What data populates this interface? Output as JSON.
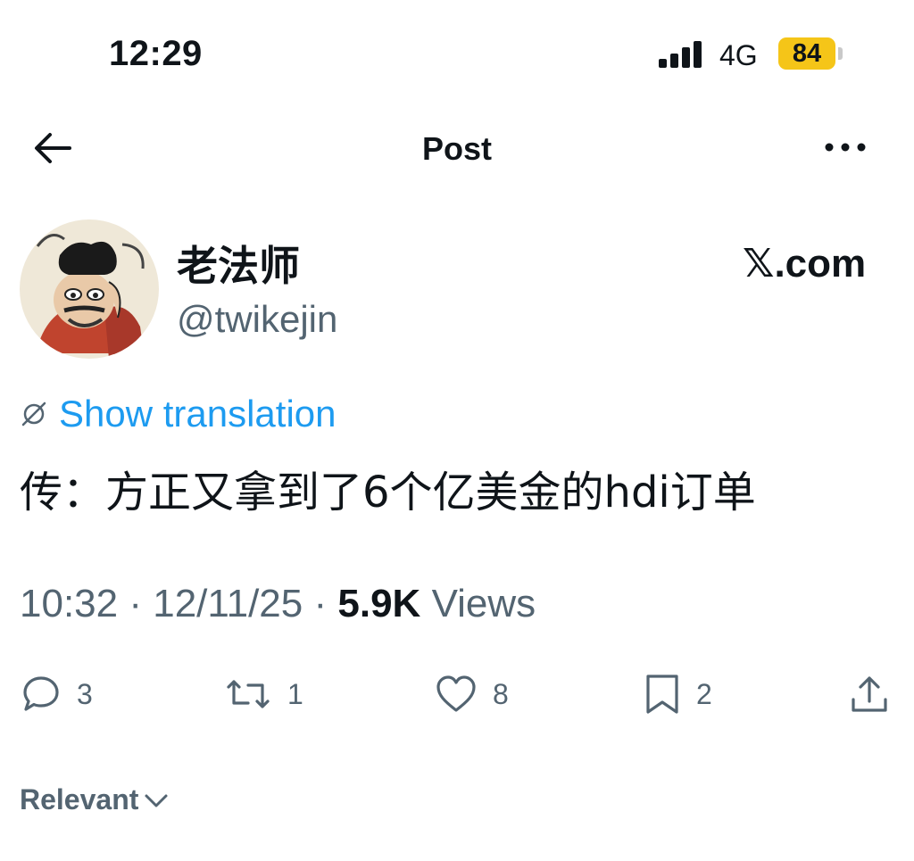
{
  "status_bar": {
    "time": "12:29",
    "network": "4G",
    "battery": "84",
    "battery_color": "#f5c518"
  },
  "nav": {
    "title": "Post",
    "back_icon": "arrow-left-icon",
    "more_icon": "more-horizontal-icon"
  },
  "author": {
    "display_name": "老法师",
    "handle": "@twikejin",
    "brand": "𝕏.com",
    "avatar": "avatar-illustration"
  },
  "post": {
    "translate_label": "Show translation",
    "text": "传：方正又拿到了6个亿美金的hdi订单"
  },
  "meta": {
    "time": "10:32",
    "separator": "·",
    "date": "12/11/25",
    "views_count": "5.9K",
    "views_label": "Views"
  },
  "actions": {
    "replies": "3",
    "reposts": "1",
    "likes": "8",
    "bookmarks": "2"
  },
  "sort": {
    "label": "Relevant"
  },
  "colors": {
    "accent": "#1d9bf0",
    "text": "#0f1419",
    "secondary": "#536471"
  }
}
